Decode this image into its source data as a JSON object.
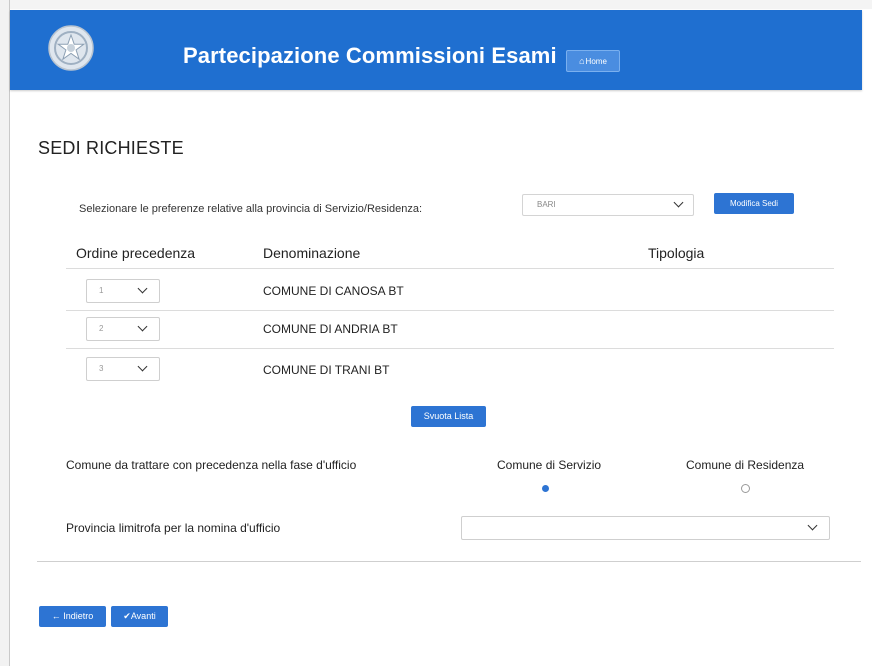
{
  "header": {
    "title": "Partecipazione Commissioni Esami",
    "home_label": "Home",
    "home_icon": "home-icon",
    "color": "#1f6fd0"
  },
  "section": {
    "title": "SEDI RICHIESTE",
    "pref_label": "Selezionare le preferenze relative alla provincia di Servizio/Residenza:",
    "province_value": "BARI",
    "modifica_label": "Modifica Sedi"
  },
  "table": {
    "headers": [
      "Ordine precedenza",
      "Denominazione",
      "Tipologia"
    ],
    "rows": [
      {
        "order": "1",
        "name": "COMUNE DI CANOSA BT"
      },
      {
        "order": "2",
        "name": "COMUNE DI ANDRIA BT"
      },
      {
        "order": "3",
        "name": "COMUNE DI TRANI BT"
      }
    ],
    "svuota_label": "Svuota Lista"
  },
  "ufficio": {
    "precedenza_label": "Comune da trattare con precedenza nella fase d'ufficio",
    "servizio_label": "Comune di Servizio",
    "residenza_label": "Comune di Residenza",
    "selected": "servizio",
    "limitrofa_label": "Provincia limitrofa per la nomina d'ufficio",
    "limitrofa_value": ""
  },
  "nav": {
    "back_label": "Indietro",
    "next_label": "Avanti",
    "accent": "#2d74d3"
  }
}
